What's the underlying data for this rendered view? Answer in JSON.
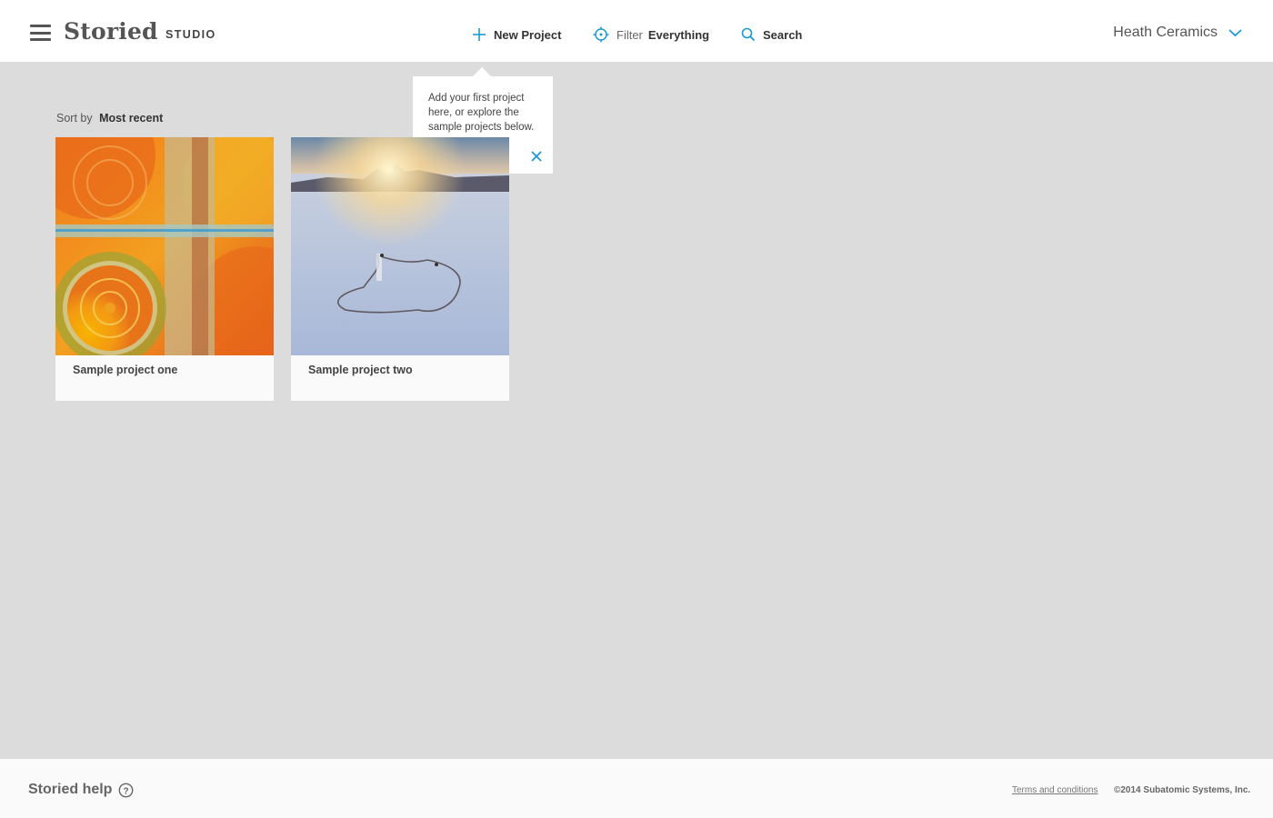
{
  "header": {
    "logo": "Storied",
    "logo_sub": "STUDIO",
    "new_project": "New Project",
    "filter_label": "Filter",
    "filter_value": "Everything",
    "search": "Search",
    "account": "Heath Ceramics"
  },
  "tooltip": {
    "text": "Add your first project here, or explore the sample projects below."
  },
  "sort": {
    "label": "Sort by",
    "value": "Most recent"
  },
  "projects": [
    {
      "title": "Sample project one"
    },
    {
      "title": "Sample project two"
    }
  ],
  "footer": {
    "help": "Storied help",
    "terms": "Terms and conditions",
    "copyright": "©2014 Subatomic Systems, Inc."
  },
  "colors": {
    "accent": "#1a9ad6",
    "background": "#dcdcdc"
  },
  "icons": [
    "menu-icon",
    "plus-icon",
    "crosshair-icon",
    "search-icon",
    "chevron-down-icon",
    "close-icon",
    "help-icon"
  ]
}
